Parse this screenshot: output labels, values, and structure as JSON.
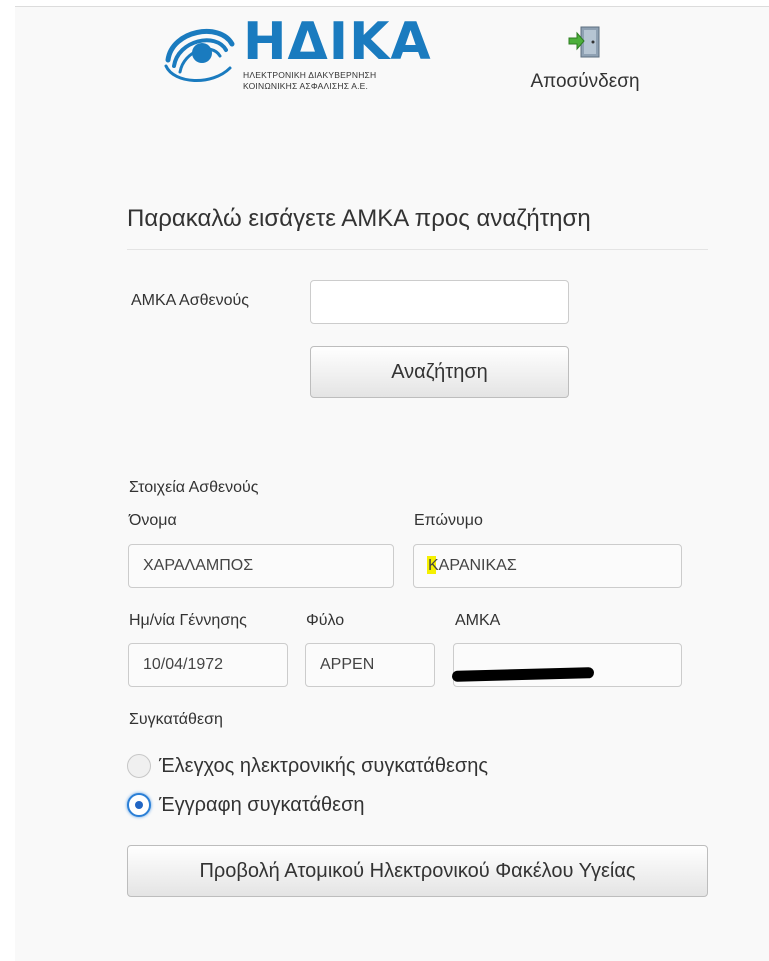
{
  "logo": {
    "name": "ΗΔΙΚΑ",
    "subtitle_line1": "ΗΛΕΚΤΡΟΝΙΚΗ ΔΙΑΚΥΒΕΡΝΗΣΗ",
    "subtitle_line2": "ΚΟΙΝΩΝΙΚΗΣ ΑΣΦΑΛΙΣΗΣ Α.Ε.",
    "brand_color": "#1a7bbf"
  },
  "header": {
    "logout_label": "Αποσύνδεση",
    "logout_icon": "door-exit-icon"
  },
  "search": {
    "heading": "Παρακαλώ εισάγετε ΑΜΚΑ προς αναζήτηση",
    "amka_label": "ΑΜΚΑ Ασθενούς",
    "amka_value": "",
    "button_label": "Αναζήτηση"
  },
  "patient": {
    "section_title": "Στοιχεία Ασθενούς",
    "first_name_label": "Όνομα",
    "first_name_value": "ΧΑΡΑΛΑΜΠΟΣ",
    "last_name_label": "Επώνυμο",
    "last_name_value": "ΚΑΡΑΝΙΚΑΣ",
    "dob_label": "Ημ/νία Γέννησης",
    "dob_value": "10/04/1972",
    "sex_label": "Φύλο",
    "sex_value": "ΑΡΡΕΝ",
    "amka_label": "ΑΜΚΑ",
    "amka_value": "(redacted)"
  },
  "consent": {
    "title": "Συγκατάθεση",
    "options": [
      {
        "label": "Έλεγχος ηλεκτρονικής συγκατάθεσης",
        "selected": false
      },
      {
        "label": "Έγγραφη συγκατάθεση",
        "selected": true
      }
    ],
    "accent_color": "#2b7fd6"
  },
  "actions": {
    "view_record_label": "Προβολή Ατομικού Ηλεκτρονικού Φακέλου Υγείας"
  }
}
